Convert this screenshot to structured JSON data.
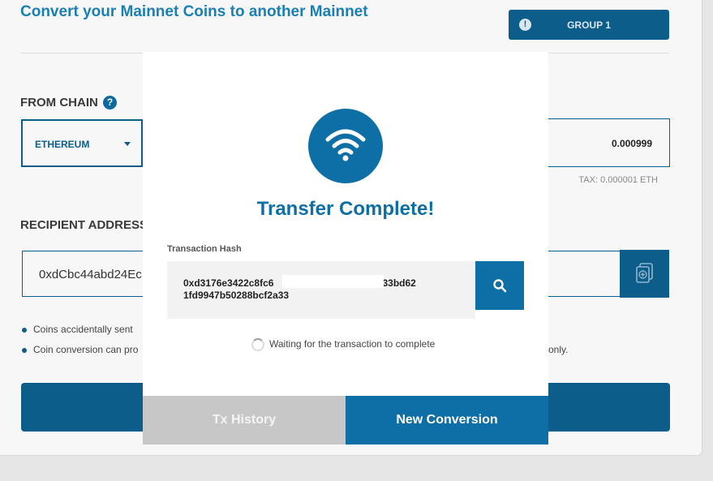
{
  "background": {
    "title": "Convert your Mainnet Coins to another Mainnet",
    "group_button": {
      "label": "GROUP 1",
      "icon": "alert-icon"
    },
    "from_chain": {
      "label": "FROM CHAIN",
      "help_icon": "?",
      "selected": "ETHEREUM",
      "amount": "0.000999",
      "tax": "TAX: 0.000001 ETH"
    },
    "recipient": {
      "label": "RECIPIENT ADDRESS",
      "value": "0xdCbc44abd24Ec"
    },
    "notes": [
      "Coins accidentally sent",
      "Coin conversion can pro"
    ],
    "note_tail": "only."
  },
  "modal": {
    "icon": "wifi-icon",
    "title": "Transfer Complete!",
    "hash_label": "Transaction Hash",
    "hash_line_1": "0xd3176e3422c8fc6                              30d4133bd62",
    "hash_line_2": "1fd9947b50288bcf2a33",
    "status": "Waiting for the transaction to complete",
    "history_button": "Tx History",
    "new_button": "New Conversion"
  },
  "colors": {
    "primary": "#0d6fa5",
    "dark_primary": "#0d5d8b",
    "disabled": "#c7c7c7"
  }
}
